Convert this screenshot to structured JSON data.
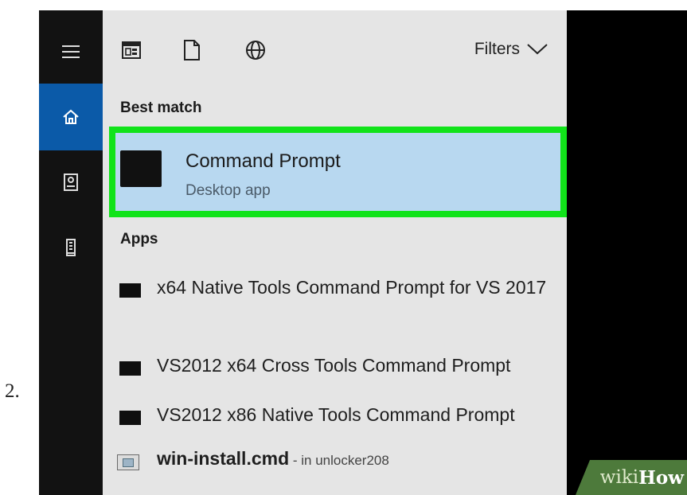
{
  "step_number": "2.",
  "panel": {
    "filters_label": "Filters",
    "best_match_label": "Best match",
    "best_match": {
      "title": "Command Prompt",
      "subtitle": "Desktop app"
    },
    "apps_label": "Apps",
    "apps": [
      {
        "label": "x64 Native Tools Command Prompt for VS 2017",
        "icon": "console-app-icon"
      },
      {
        "label": "VS2012 x64 Cross Tools Command Prompt",
        "icon": "console-app-icon"
      },
      {
        "label": "VS2012 x86 Native Tools Command Prompt",
        "icon": "console-app-icon"
      }
    ],
    "file_result": {
      "name": "win-install.cmd",
      "location": " - in unlocker208",
      "icon": "script-file-icon"
    }
  },
  "rail": {
    "icons": [
      "hamburger-menu-icon",
      "home-icon",
      "documents-icon",
      "device-icon"
    ]
  },
  "top_icons": [
    "apps-filter-icon",
    "documents-filter-icon",
    "web-filter-icon"
  ],
  "watermark": {
    "part1": "wiki",
    "part2": "How"
  },
  "colors": {
    "rail_bg": "#121212",
    "home_selected": "#0b5aa8",
    "panel_bg": "#e5e5e5",
    "selection_bg": "#b8d8f0",
    "highlight_border": "#11e31a",
    "watermark_bg": "#4d7a3b"
  }
}
